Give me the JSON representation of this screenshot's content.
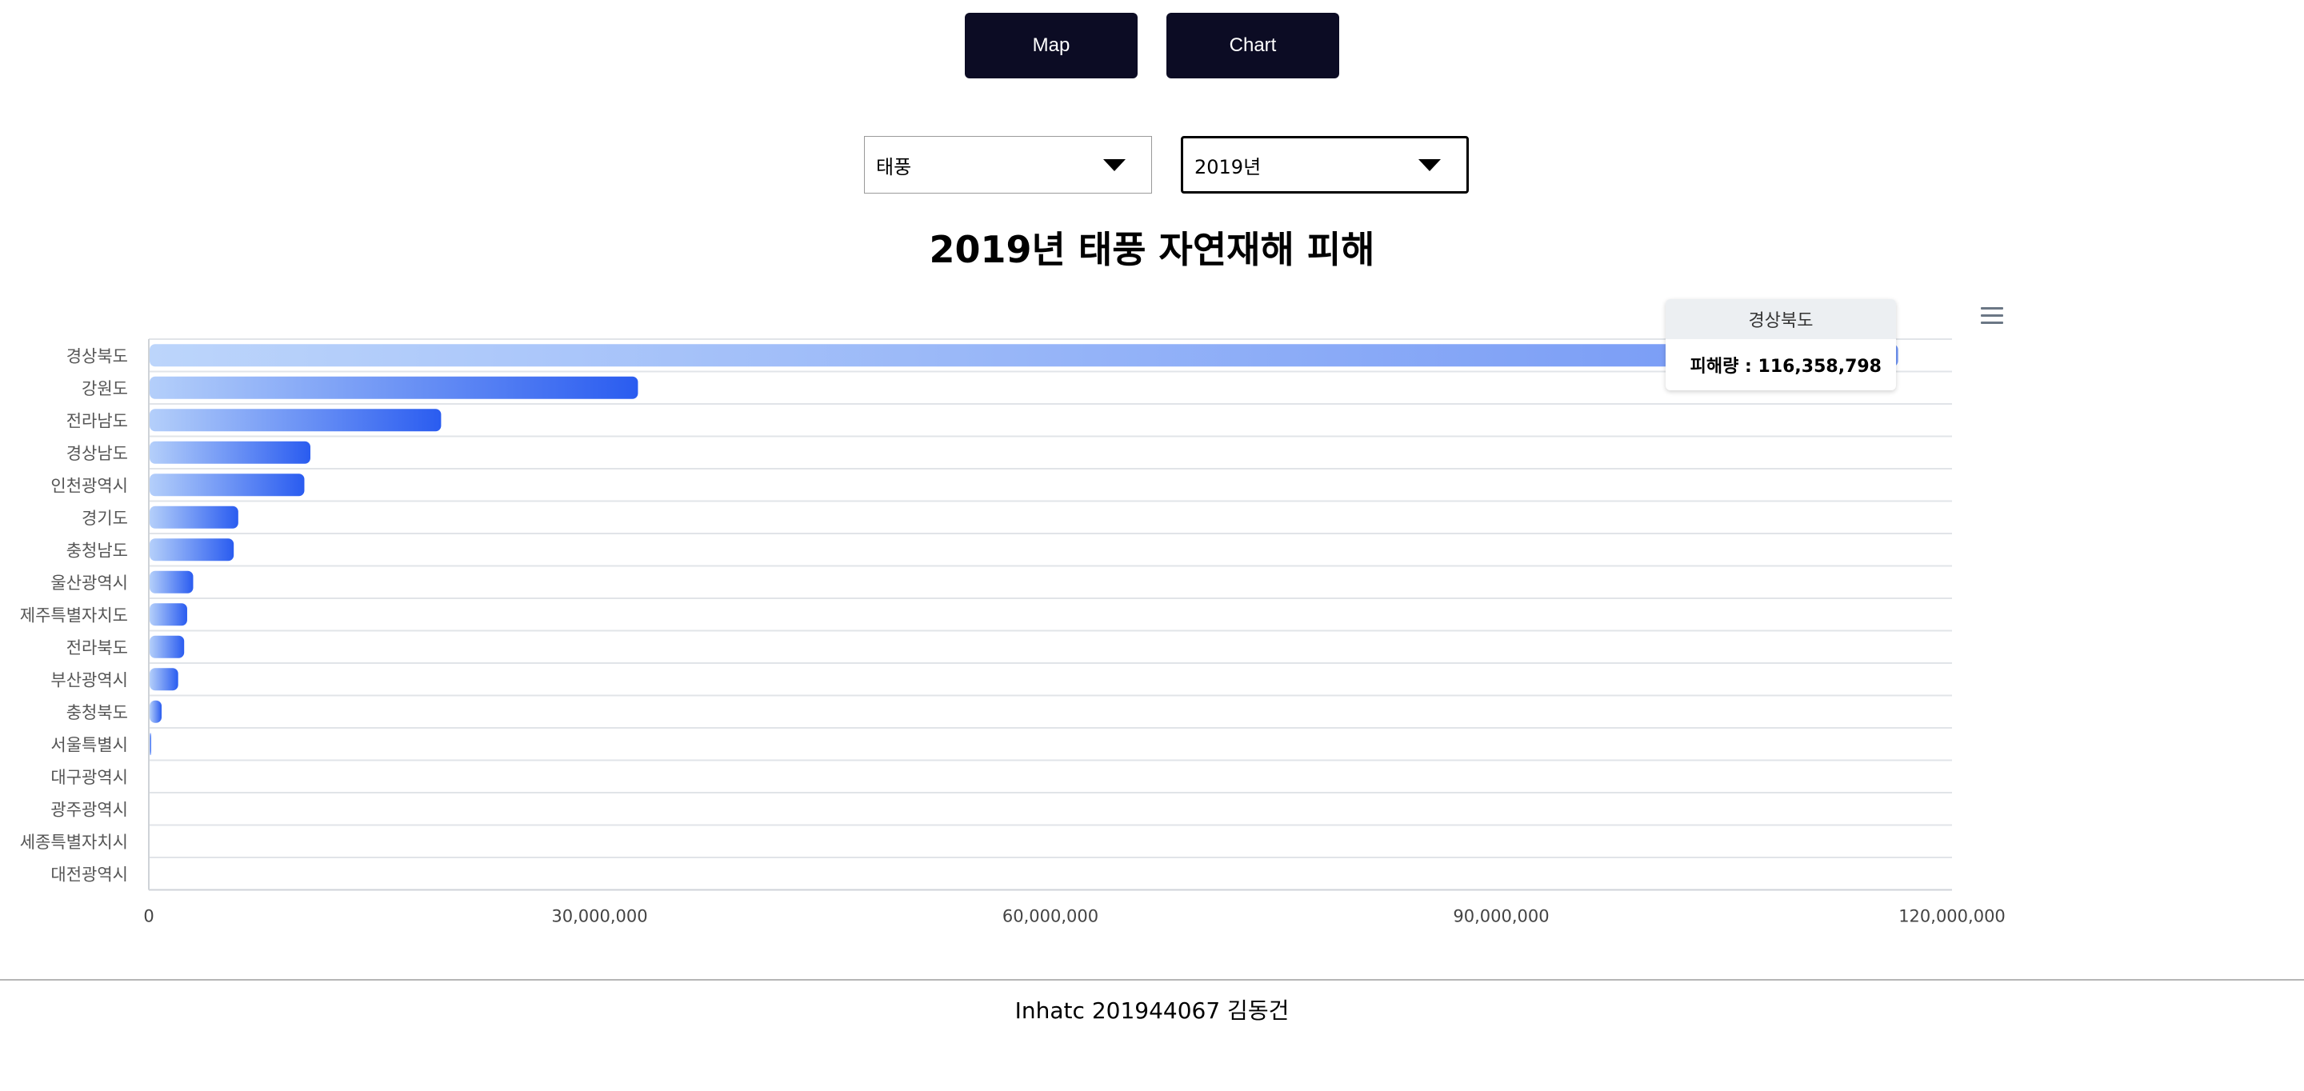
{
  "nav": {
    "map_label": "Map",
    "chart_label": "Chart"
  },
  "filters": {
    "disaster_type": "태풍",
    "year": "2019년"
  },
  "tooltip": {
    "region": "경상북도",
    "value_text": "피해량 : 116,358,798"
  },
  "footer": {
    "text": "Inhatc 201944067 김동건"
  },
  "colors": {
    "bar_light": "#b4cffa",
    "bar_dark": "#2a5cf0",
    "nav_bg": "#0c0c24"
  },
  "chart_data": {
    "type": "bar",
    "orientation": "horizontal",
    "title": "2019년 태풍 자연재해 피해",
    "categories": [
      "경상북도",
      "강원도",
      "전라남도",
      "경상남도",
      "인천광역시",
      "경기도",
      "충청남도",
      "울산광역시",
      "제주특별자치도",
      "전라북도",
      "부산광역시",
      "충청북도",
      "서울특별시",
      "대구광역시",
      "광주광역시",
      "세종특별자치시",
      "대전광역시"
    ],
    "series": [
      {
        "values": [
          116358798,
          32500000,
          19400000,
          10700000,
          10300000,
          5900000,
          5600000,
          2900000,
          2500000,
          2300000,
          1900000,
          800000,
          100000,
          0,
          0,
          0,
          0
        ]
      }
    ],
    "xlim": [
      0,
      120000000
    ],
    "xticks": [
      0,
      30000000,
      60000000,
      90000000,
      120000000
    ],
    "xtick_labels": [
      "0",
      "30,000,000",
      "60,000,000",
      "90,000,000",
      "120,000,000"
    ],
    "grid": true
  }
}
